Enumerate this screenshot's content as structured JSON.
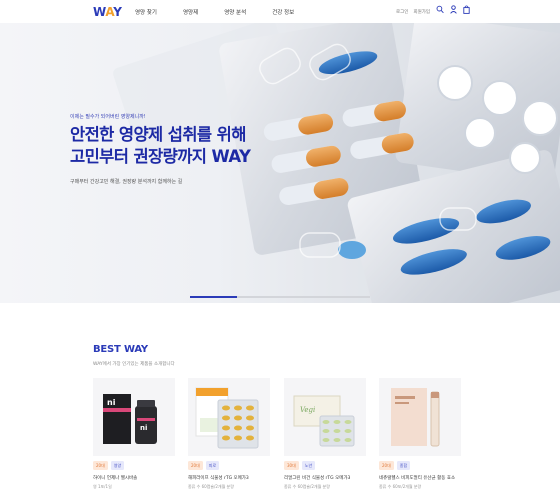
{
  "header": {
    "logo": "WAY",
    "nav": [
      "영양 찾기",
      "영양제",
      "영양 분석",
      "건강 정보"
    ],
    "util": [
      "로그인",
      "회원가입"
    ]
  },
  "hero": {
    "eyebrow": "이제는 필수가 되어버린 영양제니까!",
    "title_line1": "안전한 영양제 섭취를 위해",
    "title_line2": "고민부터 권장량까지 WAY",
    "desc": "구매부터 간강고민 해결, 권장량 분석까지 함께하는 길",
    "slide_progress": 0.26
  },
  "best": {
    "title": "BEST WAY",
    "subtitle": "WAY에서 가장 인기있는 제품을 소개합니다",
    "products": [
      {
        "tag1": "20대",
        "tag2": "영양",
        "name": "하이니 언제나 헬시바솔",
        "desc": "영 1포/1일"
      },
      {
        "tag1": "20대",
        "tag2": "피로",
        "name": "해피라이프 식물성 rTG 오메가3",
        "desc": "종류 수 60캡슐/2개월 분량"
      },
      {
        "tag1": "30대",
        "tag2": "노년",
        "name": "리얼그린 비건 식물성 rTG 오메가3",
        "desc": "종류 수 60캡슐/2개월 분량"
      },
      {
        "tag1": "20대",
        "tag2": "종합",
        "name": "네츄럴헬스 비피도멀티 유산균 활동 효소",
        "desc": "종류 수 60포/2개월 분량"
      }
    ]
  },
  "colors": {
    "brand": "#2b3bb8",
    "accent": "#f2a12d"
  }
}
